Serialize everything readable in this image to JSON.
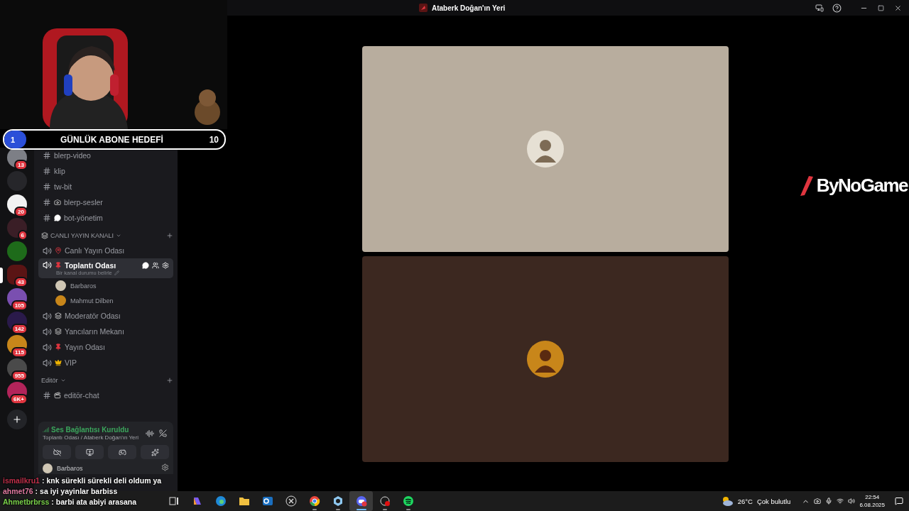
{
  "overlay": {
    "goal": {
      "count": "1",
      "label": "GÜNLÜK ABONE HEDEFİ",
      "target": "10",
      "level": 0.1
    },
    "logo": "ByNoGame"
  },
  "servers": [
    {
      "badge": "13",
      "color": "#7d7f86",
      "selected": false
    },
    {
      "color": "#26262a",
      "selected": false
    },
    {
      "badge": "20",
      "color": "#f2f2f2",
      "selected": false
    },
    {
      "badge": "6",
      "color": "#3a1e26",
      "selected": false
    },
    {
      "color": "#1e6b1a",
      "selected": false
    },
    {
      "badge": "43",
      "color": "#5a1414",
      "selected": true
    },
    {
      "badge": "105",
      "color": "#7a4fb0",
      "selected": false
    },
    {
      "badge": "142",
      "color": "#2a1a4a",
      "selected": false
    },
    {
      "badge": "115",
      "color": "#c8861a",
      "selected": false
    },
    {
      "badge": "955",
      "color": "#4a4a4a",
      "selected": false
    },
    {
      "badge": "6K+",
      "color": "#b2245a",
      "selected": false
    }
  ],
  "channels": [
    {
      "kind": "text",
      "name": "blerp-video",
      "selected": false
    },
    {
      "kind": "text",
      "name": "klip",
      "selected": false
    },
    {
      "kind": "text",
      "name": "tw-bit",
      "selected": false
    },
    {
      "kind": "text",
      "name": "blerp-sesler",
      "emoji": {
        "kind": "camera"
      },
      "selected": false
    },
    {
      "kind": "text",
      "name": "bot-yönetim",
      "emoji": {
        "kind": "bubble"
      },
      "selected": false
    },
    {
      "kind": "category",
      "name": "CANLI YAYIN KANALI",
      "emoji": {
        "kind": "spool"
      }
    },
    {
      "kind": "voice",
      "name": "Canlı Yayın Odası",
      "emoji": {
        "kind": "pushpin"
      },
      "selected": false
    },
    {
      "kind": "voice",
      "name": "Toplantı Odası",
      "emoji": {
        "kind": "pin"
      },
      "selected": true,
      "status": "Bir kanal durumu belirle",
      "members": [
        {
          "name": "Barbaros",
          "color": "#cfc6b4"
        },
        {
          "name": "Mahmut Dilben",
          "color": "#c8861a"
        }
      ]
    },
    {
      "kind": "voice",
      "name": "Moderatör Odası",
      "emoji": {
        "kind": "spool"
      },
      "selected": false
    },
    {
      "kind": "voice",
      "name": "Yancıların Mekanı",
      "emoji": {
        "kind": "spool"
      },
      "selected": false
    },
    {
      "kind": "voice",
      "name": "Yayın Odası",
      "emoji": {
        "kind": "pin"
      },
      "selected": false
    },
    {
      "kind": "voice",
      "name": "VIP",
      "emoji": {
        "kind": "crown"
      },
      "selected": false
    },
    {
      "kind": "category",
      "name": "Editör"
    },
    {
      "kind": "text",
      "name": "editör-chat",
      "emoji": {
        "kind": "clapper"
      },
      "selected": false
    }
  ],
  "voice_panel": {
    "status": "Ses Bağlantısı Kuruldu",
    "location": "Toplantı Odası / Ataberk Doğan'ın Yeri"
  },
  "user": {
    "name": "Barbaros"
  },
  "chat": [
    {
      "user": "ismailkru1",
      "color": "#c0304a",
      "separator": ":",
      "message": "knk sürekli sürekli deli oldum ya"
    },
    {
      "user": "ahmet76",
      "color": "#e07aa0",
      "separator": ":",
      "message": "sa iyi yayinlar barbiss"
    },
    {
      "user": "Ahmetbrbrss",
      "color": "#7ad04a",
      "separator": ":",
      "message": "barbi ata abiyi arasana"
    }
  ],
  "window": {
    "title": "Ataberk Doğan'ın Yeri"
  },
  "tiles": [
    {
      "color": "#b8ad9e"
    },
    {
      "color": "#3c2820"
    }
  ],
  "taskbar": {
    "apps": [
      {
        "kind": "taskview",
        "running": false,
        "selected": false
      },
      {
        "kind": "copilot",
        "running": false,
        "selected": false
      },
      {
        "kind": "edge",
        "running": false,
        "selected": false
      },
      {
        "kind": "explorer",
        "running": false,
        "selected": false
      },
      {
        "kind": "outlook",
        "running": false,
        "selected": false
      },
      {
        "kind": "xapp",
        "running": false,
        "selected": false
      },
      {
        "kind": "chrome",
        "running": true,
        "selected": false
      },
      {
        "kind": "hexapp",
        "running": true,
        "selected": false
      },
      {
        "kind": "discord",
        "running": true,
        "selected": true
      },
      {
        "kind": "recorder",
        "running": true,
        "selected": false
      },
      {
        "kind": "spotify",
        "running": true,
        "selected": false
      }
    ],
    "weather": {
      "temp": "26°C",
      "text": "Çok bulutlu"
    },
    "time": "22:54",
    "date": "6.08.2025"
  }
}
